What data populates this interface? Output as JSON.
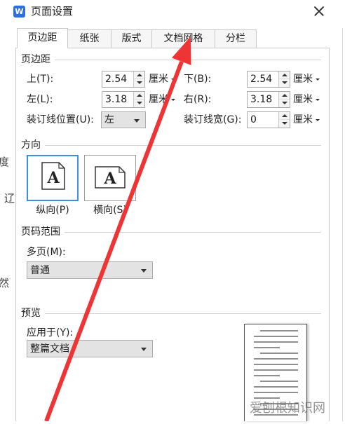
{
  "window": {
    "title": "页面设置",
    "logo_letter": "W"
  },
  "background_text": [
    "度",
    "辽",
    "然"
  ],
  "tabs": [
    {
      "label": "页边距",
      "active": true
    },
    {
      "label": "纸张",
      "active": false
    },
    {
      "label": "版式",
      "active": false
    },
    {
      "label": "文档网格",
      "active": false
    },
    {
      "label": "分栏",
      "active": false
    }
  ],
  "margins": {
    "group_label": "页边距",
    "top": {
      "label": "上(T):",
      "value": "2.54",
      "unit": "厘米"
    },
    "bottom": {
      "label": "下(B):",
      "value": "2.54",
      "unit": "厘米"
    },
    "left": {
      "label": "左(L):",
      "value": "3.18",
      "unit": "厘米"
    },
    "right": {
      "label": "右(R):",
      "value": "3.18",
      "unit": "厘米"
    },
    "gutter_position": {
      "label": "装订线位置(U):",
      "value": "左"
    },
    "gutter_width": {
      "label": "装订线宽(G):",
      "value": "0",
      "unit": "厘米"
    }
  },
  "orientation": {
    "group_label": "方向",
    "icon_letter": "A",
    "portrait_label": "纵向(P)",
    "landscape_label": "横向(S)",
    "selected": "portrait"
  },
  "page_range": {
    "group_label": "页码范围",
    "multiple_pages_label": "多页(M):",
    "multiple_pages_value": "普通"
  },
  "preview": {
    "group_label": "预览",
    "apply_to_label": "应用于(Y):",
    "apply_to_value": "整篇文档"
  },
  "watermark": "爱刨根知识网",
  "icons": {
    "logo": "wps-logo-icon",
    "close": "close-icon",
    "spinner_up": "caret-up-icon",
    "spinner_down": "caret-down-icon",
    "dropdown": "caret-down-icon",
    "portrait": "portrait-page-icon",
    "landscape": "landscape-page-icon"
  },
  "colors": {
    "logo": "#2f6ee0",
    "selected_border": "#3e8ee8",
    "annotation_arrow": "#ee3434",
    "dropdown_bg": "#e3e3e3"
  }
}
